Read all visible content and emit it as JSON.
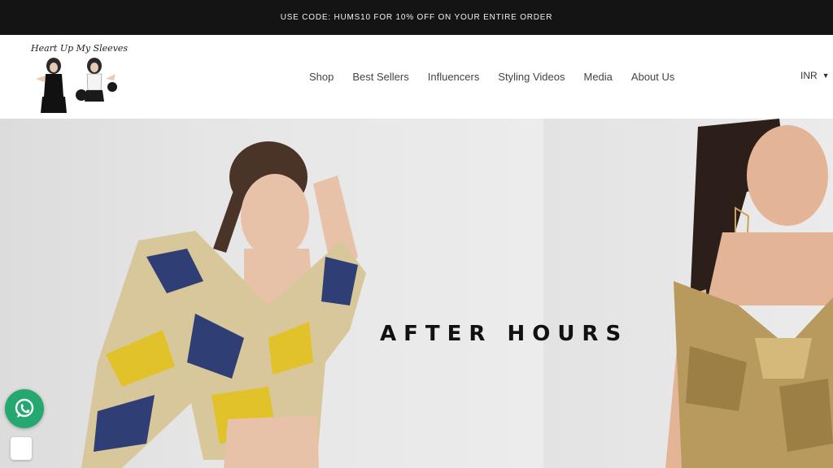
{
  "announcement": {
    "text": "USE CODE: HUMS10 FOR 10% OFF ON YOUR ENTIRE ORDER"
  },
  "header": {
    "logo_text": "Heart Up My Sleeves",
    "nav": [
      {
        "label": "Shop"
      },
      {
        "label": "Best Sellers"
      },
      {
        "label": "Influencers"
      },
      {
        "label": "Styling Videos"
      },
      {
        "label": "Media"
      },
      {
        "label": "About Us"
      }
    ],
    "currency": {
      "value": "INR",
      "icon": "chevron-down-icon"
    }
  },
  "hero": {
    "title": "AFTER HOURS",
    "left_image": "model-in-printed-balloon-sleeve-crop-top",
    "right_image": "model-in-gold-metallic-bow-top"
  },
  "floating": {
    "whatsapp_icon": "whatsapp-icon",
    "whatsapp_color": "#25a870"
  },
  "colors": {
    "announcement_bg": "#141414",
    "header_bg": "#ffffff"
  }
}
